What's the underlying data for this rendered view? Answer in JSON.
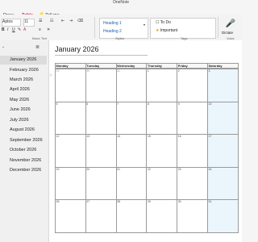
{
  "window": {
    "title": "OneNote"
  },
  "tabs": [
    "Draw",
    "Table",
    "Tell me"
  ],
  "ribbon": {
    "font_name": "Aptos",
    "font_size": "11",
    "groups": {
      "basic_text": "Basic Text",
      "styles": "Styles",
      "tags": "Tags",
      "voice": "Voice"
    },
    "styles": [
      "Heading 1",
      "Heading 2"
    ],
    "tags": [
      "To Do",
      "Important"
    ],
    "dictate_label": "Dictate"
  },
  "nav": {
    "pages": [
      "January 2026",
      "February 2026",
      "March 2026",
      "April 2026",
      "May 2026",
      "June 2026",
      "July 2026",
      "August 2026",
      "September 2026",
      "October 2026",
      "November 2026",
      "December 2026"
    ],
    "selected_index": 0
  },
  "page": {
    "heading": "January 2026",
    "weekdays": [
      "Monday",
      "Tuesday",
      "Wednesday",
      "Thursday",
      "Friday",
      "Saturday"
    ],
    "weeks": [
      [
        "29",
        "30",
        "31",
        "1",
        "2",
        "3"
      ],
      [
        "5",
        "6",
        "7",
        "8",
        "9",
        "10"
      ],
      [
        "12",
        "13",
        "14",
        "15",
        "16",
        "17"
      ],
      [
        "19",
        "20",
        "21",
        "22",
        "23",
        "24"
      ],
      [
        "26",
        "27",
        "28",
        "29",
        "30",
        "31"
      ]
    ],
    "grey_first_row_count": 3
  },
  "colors": {
    "saturday_fill": "#eaf6fb",
    "accent": "#c0306a"
  }
}
